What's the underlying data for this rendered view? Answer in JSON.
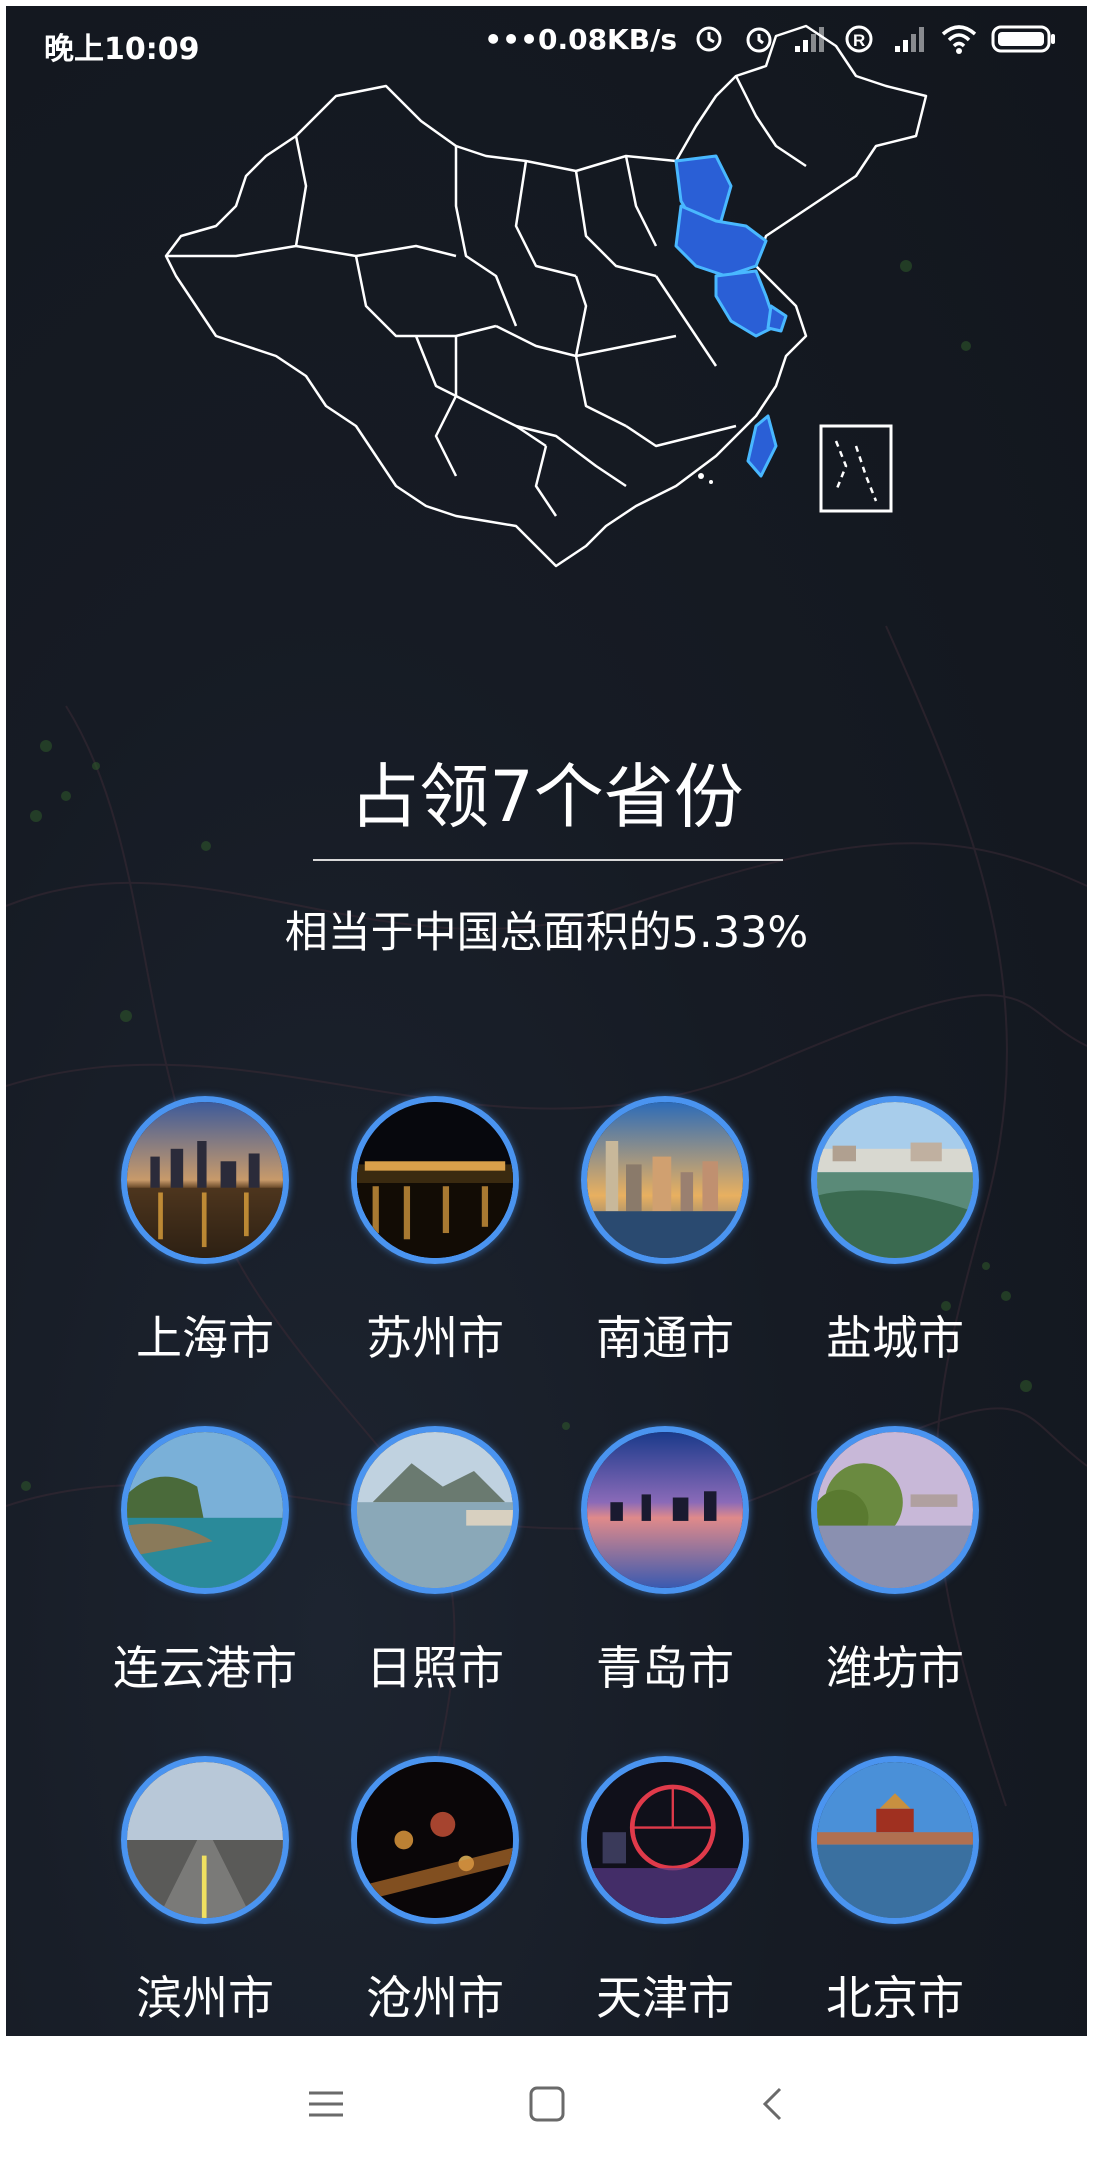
{
  "status_bar": {
    "time": "晚上10:09",
    "network_speed": "•••0.08KB/s",
    "icons": [
      "sync-icon",
      "alarm-icon",
      "signal-icon",
      "roaming-icon",
      "signal-icon",
      "wifi-icon",
      "battery-icon"
    ]
  },
  "map": {
    "icon": "china-map-icon",
    "highlight_color": "#2a5fd6",
    "outline_color": "#ffffff"
  },
  "headline": "占领7个省份",
  "subline": "相当于中国总面积的5.33%",
  "cities": [
    {
      "name": "上海市",
      "scene": "city-night-skyline"
    },
    {
      "name": "苏州市",
      "scene": "night-waterfront"
    },
    {
      "name": "南通市",
      "scene": "city-dusk-skyline"
    },
    {
      "name": "盐城市",
      "scene": "river-park"
    },
    {
      "name": "连云港市",
      "scene": "coastal-cliff"
    },
    {
      "name": "日照市",
      "scene": "mountain-bay"
    },
    {
      "name": "青岛市",
      "scene": "sunset-bay"
    },
    {
      "name": "潍坊市",
      "scene": "lake-willows"
    },
    {
      "name": "滨州市",
      "scene": "highway-bridge"
    },
    {
      "name": "沧州市",
      "scene": "night-city-lights"
    },
    {
      "name": "天津市",
      "scene": "ferris-wheel-night"
    },
    {
      "name": "北京市",
      "scene": "palace-moat"
    }
  ],
  "accent_color": "#4a94f0",
  "nav_bar": {
    "menu_icon": "menu-icon",
    "home_icon": "home-icon",
    "back_icon": "back-icon"
  }
}
